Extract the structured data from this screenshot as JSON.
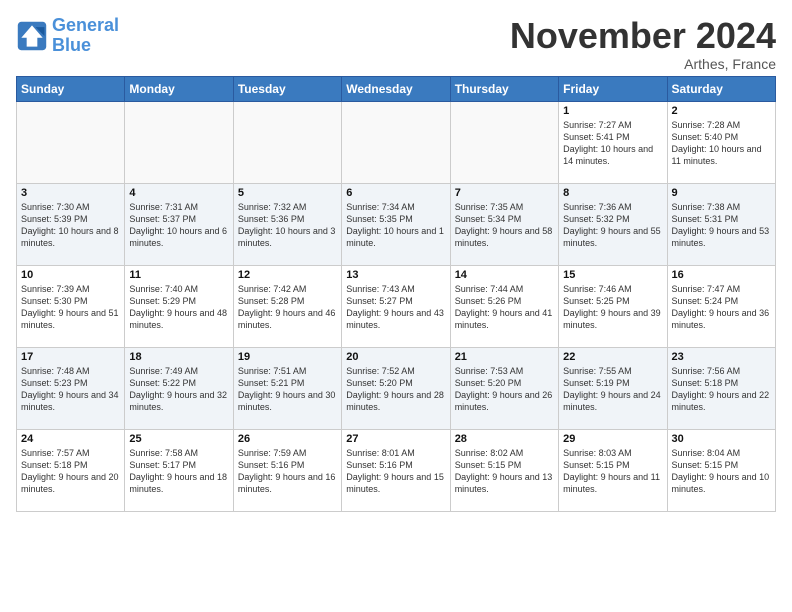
{
  "header": {
    "logo_general": "General",
    "logo_blue": "Blue",
    "month_title": "November 2024",
    "subtitle": "Arthes, France"
  },
  "weekdays": [
    "Sunday",
    "Monday",
    "Tuesday",
    "Wednesday",
    "Thursday",
    "Friday",
    "Saturday"
  ],
  "weeks": [
    [
      {
        "day": "",
        "info": ""
      },
      {
        "day": "",
        "info": ""
      },
      {
        "day": "",
        "info": ""
      },
      {
        "day": "",
        "info": ""
      },
      {
        "day": "",
        "info": ""
      },
      {
        "day": "1",
        "info": "Sunrise: 7:27 AM\nSunset: 5:41 PM\nDaylight: 10 hours and 14 minutes."
      },
      {
        "day": "2",
        "info": "Sunrise: 7:28 AM\nSunset: 5:40 PM\nDaylight: 10 hours and 11 minutes."
      }
    ],
    [
      {
        "day": "3",
        "info": "Sunrise: 7:30 AM\nSunset: 5:39 PM\nDaylight: 10 hours and 8 minutes."
      },
      {
        "day": "4",
        "info": "Sunrise: 7:31 AM\nSunset: 5:37 PM\nDaylight: 10 hours and 6 minutes."
      },
      {
        "day": "5",
        "info": "Sunrise: 7:32 AM\nSunset: 5:36 PM\nDaylight: 10 hours and 3 minutes."
      },
      {
        "day": "6",
        "info": "Sunrise: 7:34 AM\nSunset: 5:35 PM\nDaylight: 10 hours and 1 minute."
      },
      {
        "day": "7",
        "info": "Sunrise: 7:35 AM\nSunset: 5:34 PM\nDaylight: 9 hours and 58 minutes."
      },
      {
        "day": "8",
        "info": "Sunrise: 7:36 AM\nSunset: 5:32 PM\nDaylight: 9 hours and 55 minutes."
      },
      {
        "day": "9",
        "info": "Sunrise: 7:38 AM\nSunset: 5:31 PM\nDaylight: 9 hours and 53 minutes."
      }
    ],
    [
      {
        "day": "10",
        "info": "Sunrise: 7:39 AM\nSunset: 5:30 PM\nDaylight: 9 hours and 51 minutes."
      },
      {
        "day": "11",
        "info": "Sunrise: 7:40 AM\nSunset: 5:29 PM\nDaylight: 9 hours and 48 minutes."
      },
      {
        "day": "12",
        "info": "Sunrise: 7:42 AM\nSunset: 5:28 PM\nDaylight: 9 hours and 46 minutes."
      },
      {
        "day": "13",
        "info": "Sunrise: 7:43 AM\nSunset: 5:27 PM\nDaylight: 9 hours and 43 minutes."
      },
      {
        "day": "14",
        "info": "Sunrise: 7:44 AM\nSunset: 5:26 PM\nDaylight: 9 hours and 41 minutes."
      },
      {
        "day": "15",
        "info": "Sunrise: 7:46 AM\nSunset: 5:25 PM\nDaylight: 9 hours and 39 minutes."
      },
      {
        "day": "16",
        "info": "Sunrise: 7:47 AM\nSunset: 5:24 PM\nDaylight: 9 hours and 36 minutes."
      }
    ],
    [
      {
        "day": "17",
        "info": "Sunrise: 7:48 AM\nSunset: 5:23 PM\nDaylight: 9 hours and 34 minutes."
      },
      {
        "day": "18",
        "info": "Sunrise: 7:49 AM\nSunset: 5:22 PM\nDaylight: 9 hours and 32 minutes."
      },
      {
        "day": "19",
        "info": "Sunrise: 7:51 AM\nSunset: 5:21 PM\nDaylight: 9 hours and 30 minutes."
      },
      {
        "day": "20",
        "info": "Sunrise: 7:52 AM\nSunset: 5:20 PM\nDaylight: 9 hours and 28 minutes."
      },
      {
        "day": "21",
        "info": "Sunrise: 7:53 AM\nSunset: 5:20 PM\nDaylight: 9 hours and 26 minutes."
      },
      {
        "day": "22",
        "info": "Sunrise: 7:55 AM\nSunset: 5:19 PM\nDaylight: 9 hours and 24 minutes."
      },
      {
        "day": "23",
        "info": "Sunrise: 7:56 AM\nSunset: 5:18 PM\nDaylight: 9 hours and 22 minutes."
      }
    ],
    [
      {
        "day": "24",
        "info": "Sunrise: 7:57 AM\nSunset: 5:18 PM\nDaylight: 9 hours and 20 minutes."
      },
      {
        "day": "25",
        "info": "Sunrise: 7:58 AM\nSunset: 5:17 PM\nDaylight: 9 hours and 18 minutes."
      },
      {
        "day": "26",
        "info": "Sunrise: 7:59 AM\nSunset: 5:16 PM\nDaylight: 9 hours and 16 minutes."
      },
      {
        "day": "27",
        "info": "Sunrise: 8:01 AM\nSunset: 5:16 PM\nDaylight: 9 hours and 15 minutes."
      },
      {
        "day": "28",
        "info": "Sunrise: 8:02 AM\nSunset: 5:15 PM\nDaylight: 9 hours and 13 minutes."
      },
      {
        "day": "29",
        "info": "Sunrise: 8:03 AM\nSunset: 5:15 PM\nDaylight: 9 hours and 11 minutes."
      },
      {
        "day": "30",
        "info": "Sunrise: 8:04 AM\nSunset: 5:15 PM\nDaylight: 9 hours and 10 minutes."
      }
    ]
  ]
}
